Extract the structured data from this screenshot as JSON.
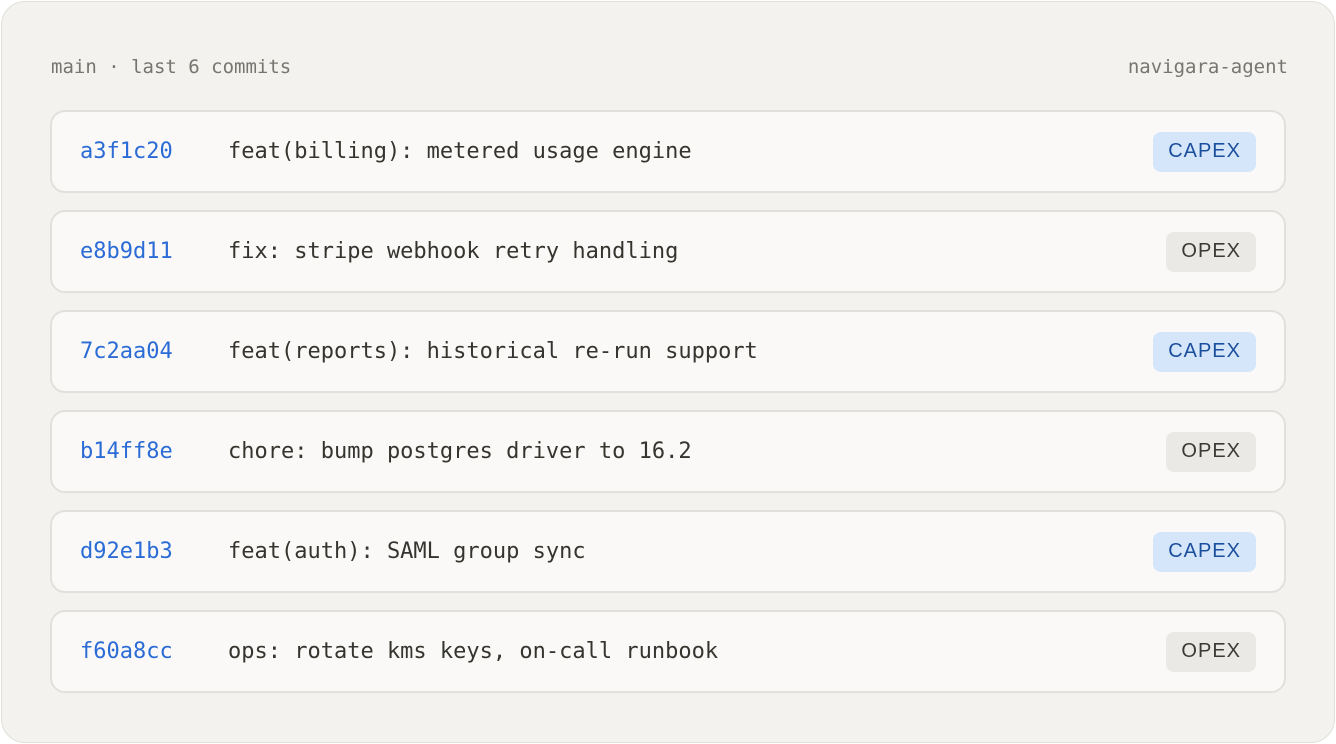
{
  "header": {
    "branch_label": "main · last 6 commits",
    "agent_label": "navigara-agent"
  },
  "commits": [
    {
      "hash": "a3f1c20",
      "message": "feat(billing): metered usage engine",
      "category": "CAPEX"
    },
    {
      "hash": "e8b9d11",
      "message": "fix: stripe webhook retry handling",
      "category": "OPEX"
    },
    {
      "hash": "7c2aa04",
      "message": "feat(reports): historical re-run support",
      "category": "CAPEX"
    },
    {
      "hash": "b14ff8e",
      "message": "chore: bump postgres driver to 16.2",
      "category": "OPEX"
    },
    {
      "hash": "d92e1b3",
      "message": "feat(auth): SAML group sync",
      "category": "CAPEX"
    },
    {
      "hash": "f60a8cc",
      "message": "ops: rotate kms keys, on-call runbook",
      "category": "OPEX"
    }
  ],
  "colors": {
    "hash": "#2b6bd6",
    "capex_bg": "#d5e6fb",
    "capex_text": "#1b4f9c",
    "opex_bg": "#ebe9e5",
    "opex_text": "#3b3a35"
  }
}
